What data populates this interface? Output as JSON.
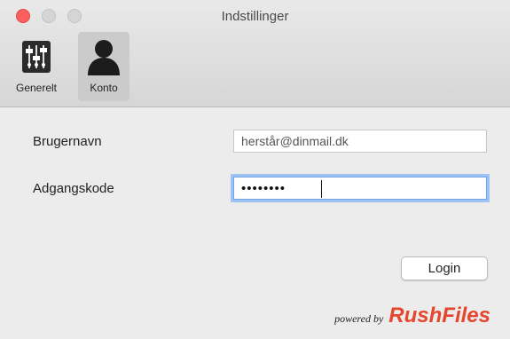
{
  "window": {
    "title": "Indstillinger"
  },
  "toolbar": {
    "tabs": [
      {
        "label": "Generelt",
        "icon": "sliders-icon",
        "selected": false
      },
      {
        "label": "Konto",
        "icon": "user-silhouette-icon",
        "selected": true
      }
    ]
  },
  "form": {
    "username_label": "Brugernavn",
    "username_value": "herstår@dinmail.dk",
    "password_label": "Adgangskode",
    "password_value": "••••••••",
    "login_label": "Login"
  },
  "footer": {
    "powered_by": "powered by",
    "brand": "RushFiles"
  },
  "colors": {
    "close_light": "#fc605c",
    "focus_ring": "#9cc3f2",
    "brand": "#e5462e"
  }
}
